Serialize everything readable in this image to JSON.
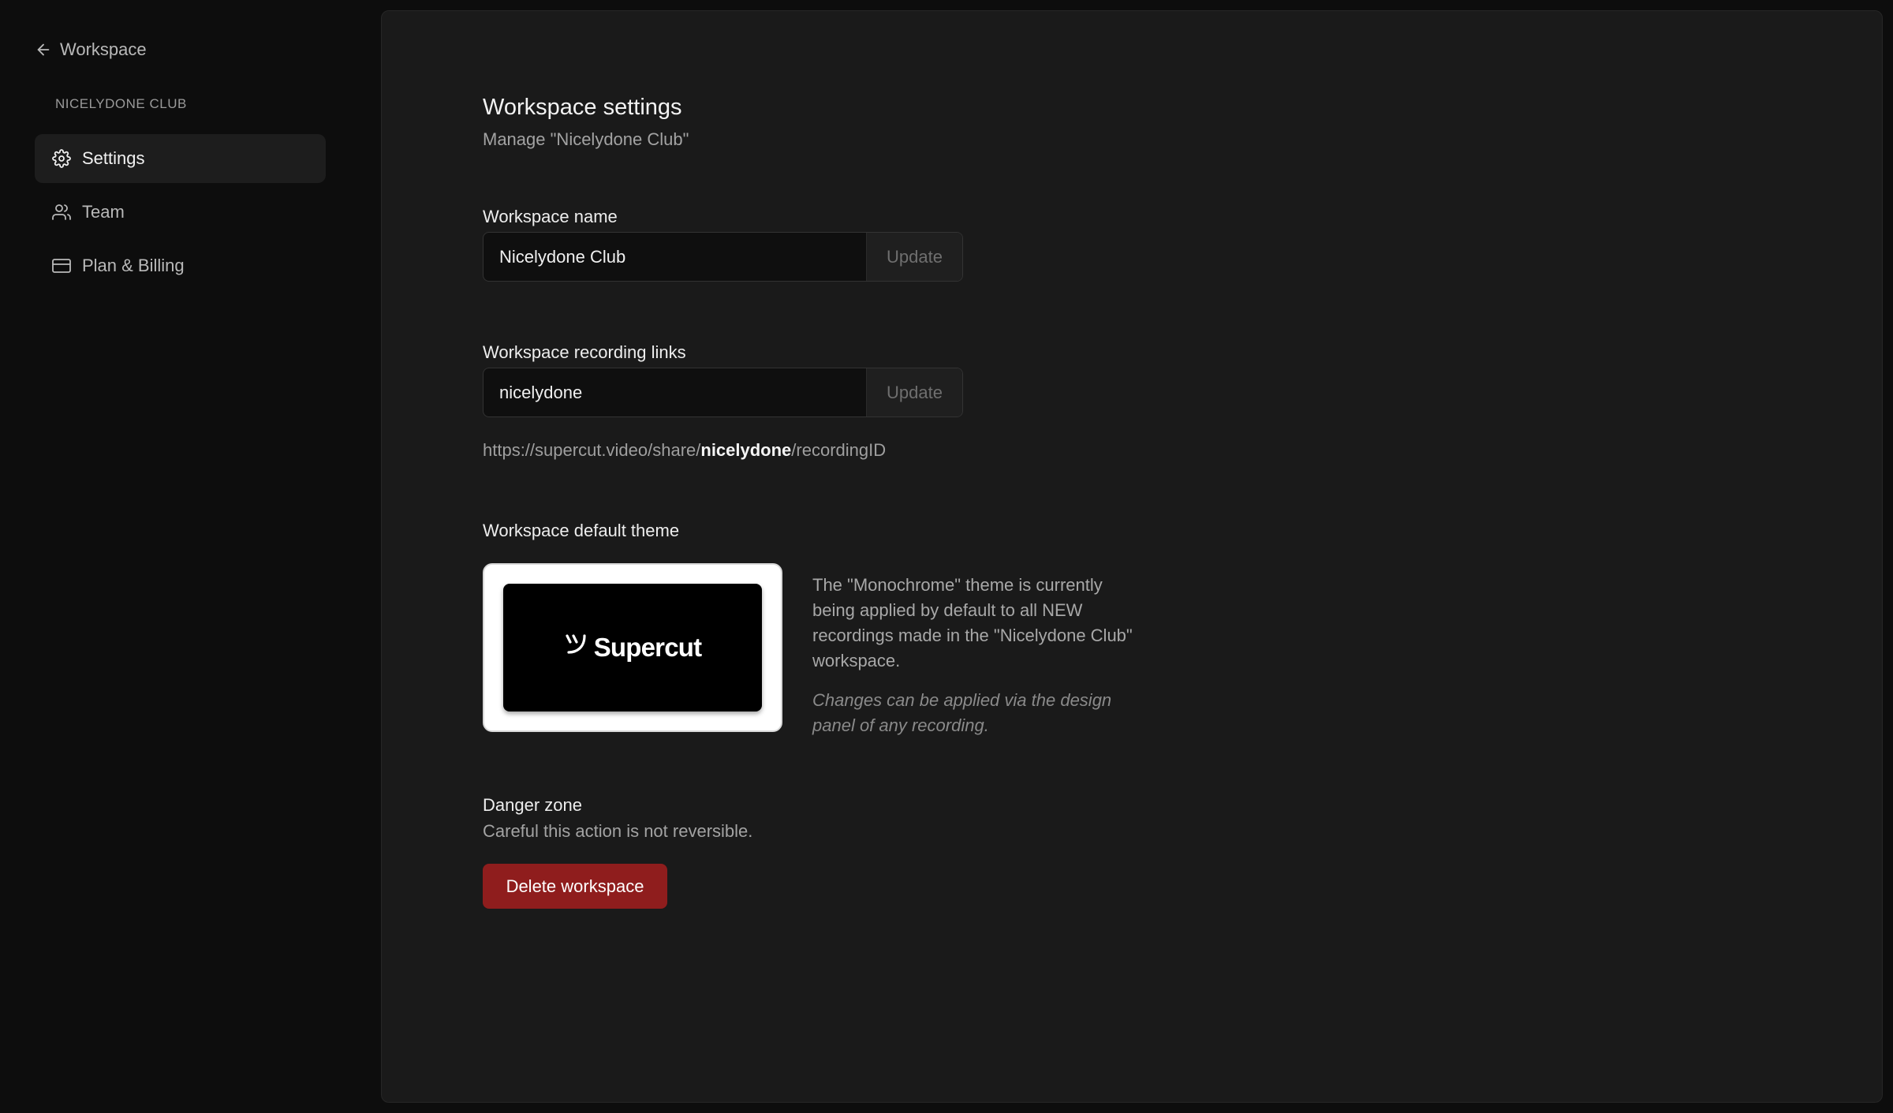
{
  "sidebar": {
    "back_label": "Workspace",
    "org_name": "NICELYDONE CLUB",
    "items": [
      {
        "label": "Settings",
        "icon": "gear-icon",
        "active": true
      },
      {
        "label": "Team",
        "icon": "users-icon",
        "active": false
      },
      {
        "label": "Plan & Billing",
        "icon": "credit-card-icon",
        "active": false
      }
    ]
  },
  "main": {
    "title": "Workspace settings",
    "subtitle": "Manage \"Nicelydone Club\"",
    "workspace_name": {
      "label": "Workspace name",
      "value": "Nicelydone Club",
      "button": "Update"
    },
    "recording_links": {
      "label": "Workspace recording links",
      "value": "nicelydone",
      "button": "Update",
      "preview_prefix": "https://supercut.video/share/",
      "preview_slug": "nicelydone",
      "preview_suffix": "/recordingID"
    },
    "theme": {
      "label": "Workspace default theme",
      "card_logo_text": "Supercut",
      "description": "The \"Monochrome\" theme is currently being applied by default to all NEW recordings made in the \"Nicelydone Club\" workspace.",
      "note": "Changes can be applied via the design panel of any recording."
    },
    "danger": {
      "title": "Danger zone",
      "description": "Careful this action is not reversible.",
      "button": "Delete workspace"
    }
  },
  "colors": {
    "background": "#0d0d0d",
    "panel": "#1a1a1a",
    "danger": "#8f1d1d"
  }
}
